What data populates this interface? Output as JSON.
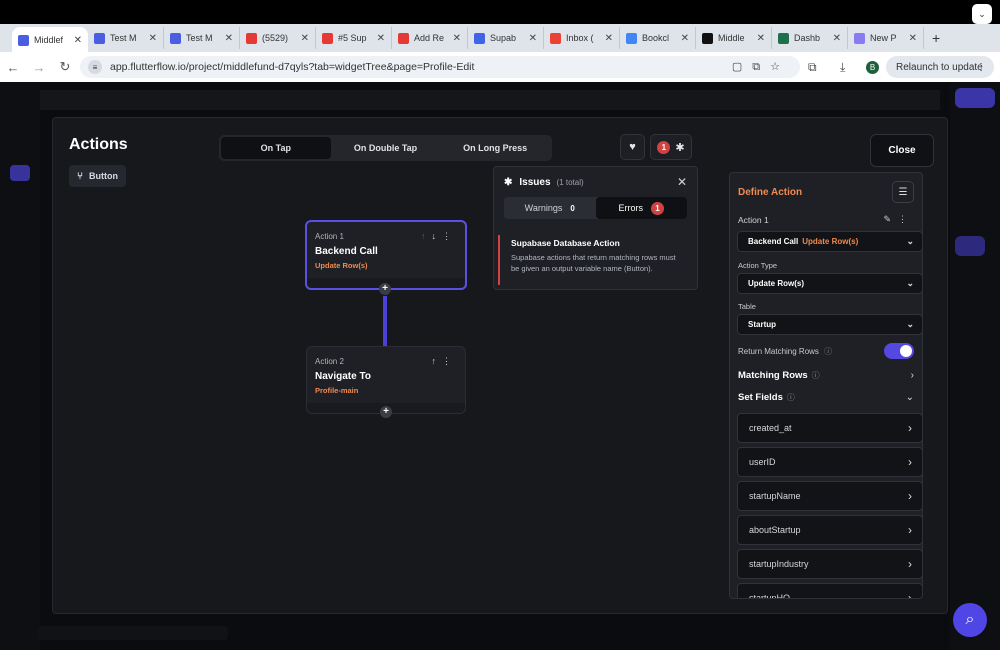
{
  "browser": {
    "tabs": [
      {
        "title": "Middlef",
        "icon": "flutterflow-icon",
        "color": "#4b5de0",
        "active": true
      },
      {
        "title": "Test M",
        "icon": "flutterflow-icon",
        "color": "#4b5de0"
      },
      {
        "title": "Test M",
        "icon": "flutterflow-icon",
        "color": "#4b5de0"
      },
      {
        "title": "(5529)",
        "icon": "youtube-icon",
        "color": "#e53935"
      },
      {
        "title": "#5 Sup",
        "icon": "youtube-icon",
        "color": "#e53935"
      },
      {
        "title": "Add Re",
        "icon": "youtube-icon",
        "color": "#e53935"
      },
      {
        "title": "Supab",
        "icon": "supabase-icon",
        "color": "#4063e8"
      },
      {
        "title": "Inbox (",
        "icon": "gmail-icon",
        "color": "#ea4335"
      },
      {
        "title": "Bookcl",
        "icon": "docs-icon",
        "color": "#4285f4"
      },
      {
        "title": "Middle",
        "icon": "x-icon",
        "color": "#111111"
      },
      {
        "title": "Dashb",
        "icon": "dashboard-icon",
        "color": "#1e6f4b"
      },
      {
        "title": "New P",
        "icon": "flutterflow-icon",
        "color": "#8a7cf0"
      }
    ],
    "url": "app.flutterflow.io/project/middlefund-d7qyls?tab=widgetTree&page=Profile-Edit",
    "profile_initial": "B",
    "relaunch_label": "Relaunch to update"
  },
  "modal": {
    "title": "Actions",
    "widget_chip": "Button",
    "triggers": [
      "On Tap",
      "On Double Tap",
      "On Long Press"
    ],
    "selected_trigger": "On Tap",
    "error_count": "1",
    "close_label": "Close"
  },
  "actions": [
    {
      "number": "Action 1",
      "name": "Backend Call",
      "detail": "Update Row(s)"
    },
    {
      "number": "Action 2",
      "name": "Navigate To",
      "detail": "Profile-main"
    }
  ],
  "issues": {
    "title": "Issues",
    "total": "(1 total)",
    "tabs": [
      {
        "label": "Warnings",
        "count": "0"
      },
      {
        "label": "Errors",
        "count": "1"
      }
    ],
    "item_title": "Supabase Database Action",
    "item_desc": "Supabase actions that return matching rows must be given an output variable name (Button)."
  },
  "define": {
    "title": "Define Action",
    "action_label": "Action 1",
    "action_value": "Backend Call",
    "action_value_detail": "Update Row(s)",
    "type_label": "Action Type",
    "type_value": "Update Row(s)",
    "table_label": "Table",
    "table_value": "Startup",
    "return_label": "Return Matching Rows",
    "return_enabled": true,
    "matching_rows_label": "Matching Rows",
    "set_fields_label": "Set Fields",
    "fields": [
      "created_at",
      "userID",
      "startupName",
      "aboutStartup",
      "startupIndustry",
      "startupHQ"
    ]
  }
}
